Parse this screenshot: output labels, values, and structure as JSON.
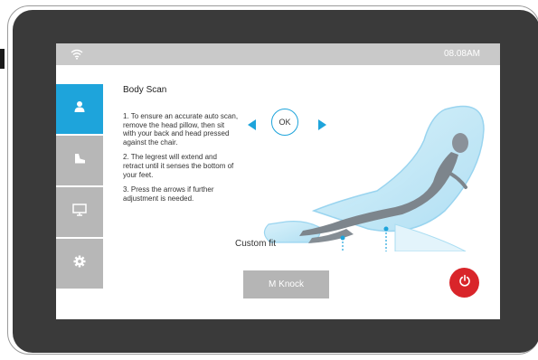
{
  "status_bar": {
    "time": "08.08AM",
    "wifi_icon": "wifi-icon"
  },
  "sidebar": {
    "items": [
      {
        "icon": "person-icon",
        "active": true
      },
      {
        "icon": "foot-icon",
        "active": false
      },
      {
        "icon": "monitor-icon",
        "active": false
      },
      {
        "icon": "gear-icon",
        "active": false
      }
    ]
  },
  "panel": {
    "title": "Body Scan",
    "instructions": [
      "1. To ensure an accurate auto scan, remove the head pillow, then sit with your back and head pressed against the chair.",
      "2. The legrest will extend and retract until it senses the bottom of your feet.",
      "3. Press the arrows if further adjustment is needed."
    ]
  },
  "controls": {
    "ok_label": "OK",
    "left_icon": "left-arrow-icon",
    "right_icon": "right-arrow-icon"
  },
  "illustration": {
    "custom_fit_label": "Custom fit"
  },
  "knock_button": {
    "label": "M Knock"
  },
  "power_button": {
    "icon": "power-icon"
  },
  "colors": {
    "accent": "#1ea4db",
    "status_bar": "#c9c9c9",
    "sidebar_inactive": "#b7b7b7",
    "power": "#d9252a",
    "bezel": "#3a3a3a"
  }
}
